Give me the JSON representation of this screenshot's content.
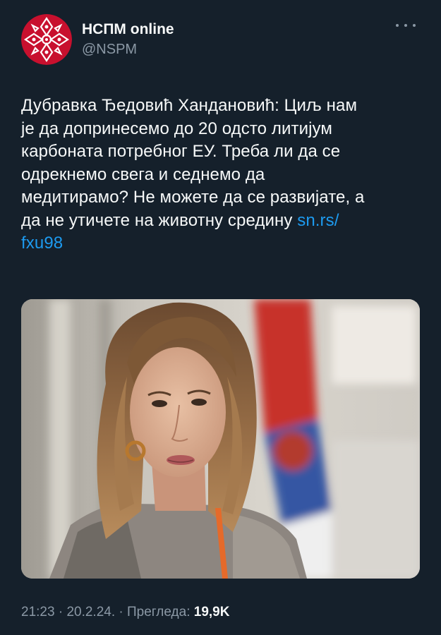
{
  "author": {
    "display_name": "НСПМ online",
    "handle": "@NSPM",
    "avatar_icon": "red-ornament-logo-icon"
  },
  "menu_icon": "more-dots-icon",
  "tweet": {
    "text": "Дубравка Ђедовић Хандановић: Циљ нам је да допринесемо до 20 одсто литијум карбоната потребног ЕУ. Треба ли да се одрекнемо свега и седнемо да медитирамо? Не можете да се развијате, а да не утичете на животну средину",
    "link_line1": "sn.rs/",
    "link_line2": "fxu98",
    "line1": "Дубравка Ђедовић Хандановић: Циљ нам",
    "line2": "је да допринесемо до 20 одсто литијум",
    "line3": "карбоната потребног ЕУ. Треба ли да се",
    "line4": "одрекнемо свега и седнемо да",
    "line5": "медитирамо? Не можете да се развијате, а",
    "line6": "да не утичете на животну средину "
  },
  "media": {
    "type": "photo",
    "description_icon": "portrait-photo-icon"
  },
  "footer": {
    "time": "21:23",
    "sep1": " · ",
    "date": "20.2.24.",
    "sep2": " · ",
    "views_label": "Прегледа: ",
    "views_count": "19,9K"
  },
  "colors": {
    "background": "#15202b",
    "text": "#f7f9f9",
    "secondary": "#8b98a5",
    "link": "#1d9bf0",
    "logo_red": "#c8102e"
  }
}
